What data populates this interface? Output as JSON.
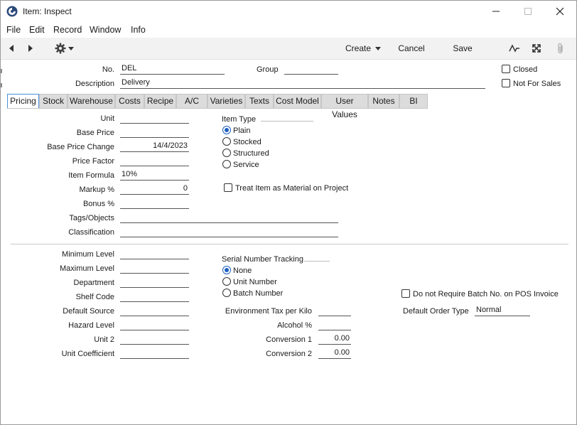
{
  "window": {
    "title": "Item: Inspect",
    "min_glyph": "—",
    "max_glyph": "☐",
    "close_glyph": "✕"
  },
  "menu": [
    "File",
    "Edit",
    "Record",
    "Window",
    "Info"
  ],
  "toolbar": {
    "create_label": "Create",
    "cancel_label": "Cancel",
    "save_label": "Save"
  },
  "header": {
    "no_label": "No.",
    "no_value": "DEL",
    "group_label": "Group",
    "group_value": "",
    "description_label": "Description",
    "description_value": "Delivery",
    "closed_label": "Closed",
    "not_for_sales_label": "Not For Sales"
  },
  "tabs": [
    "Pricing",
    "Stock",
    "Warehouse",
    "Costs",
    "Recipe",
    "A/C",
    "Varieties",
    "Texts",
    "Cost Model",
    "User Values",
    "Notes",
    "BI"
  ],
  "pricing": {
    "unit_label": "Unit",
    "unit_value": "",
    "base_price_label": "Base Price",
    "base_price_value": "",
    "base_price_change_label": "Base Price Change",
    "base_price_change_value": "14/4/2023",
    "price_factor_label": "Price Factor",
    "price_factor_value": "",
    "item_formula_label": "Item Formula",
    "item_formula_value": "10%",
    "markup_label": "Markup %",
    "markup_value": "0",
    "bonus_label": "Bonus %",
    "bonus_value": "",
    "tags_label": "Tags/Objects",
    "tags_value": "",
    "classification_label": "Classification",
    "classification_value": "",
    "item_type_label": "Item Type",
    "item_type_options": [
      "Plain",
      "Stocked",
      "Structured",
      "Service"
    ],
    "item_type_selected": "Plain",
    "treat_material_label": "Treat Item as Material on Project"
  },
  "lower": {
    "minimum_level_label": "Minimum Level",
    "maximum_level_label": "Maximum Level",
    "department_label": "Department",
    "shelf_code_label": "Shelf Code",
    "default_source_label": "Default Source",
    "hazard_level_label": "Hazard Level",
    "unit2_label": "Unit 2",
    "unit_coefficient_label": "Unit Coefficient",
    "serial_tracking_label": "Serial Number Tracking",
    "serial_options": [
      "None",
      "Unit Number",
      "Batch Number"
    ],
    "serial_selected": "None",
    "env_tax_label": "Environment Tax per Kilo",
    "alcohol_label": "Alcohol %",
    "conversion1_label": "Conversion 1",
    "conversion1_value": "0.00",
    "conversion2_label": "Conversion 2",
    "conversion2_value": "0.00",
    "no_batch_pos_label": "Do not Require Batch No. on POS Invoice",
    "default_order_type_label": "Default Order Type",
    "default_order_type_value": "Normal"
  },
  "colors": {
    "accent": "#1e5fbf",
    "toolbar_bg": "#f2f2f2",
    "tab_bg": "#dcdcdc",
    "active_tab_border": "#4a90d9"
  }
}
